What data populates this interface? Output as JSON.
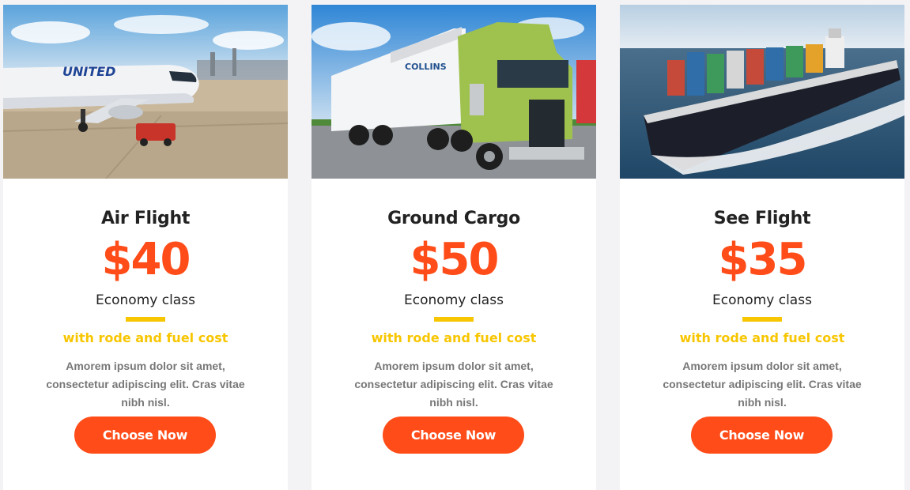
{
  "colors": {
    "accent": "#ff4c18",
    "highlight": "#f7c600",
    "background": "#f3f3f5",
    "card": "#ffffff"
  },
  "cards": [
    {
      "image": "airplane-photo",
      "title": "Air Flight",
      "price": "$40",
      "class_label": "Economy class",
      "note": "with rode and fuel cost",
      "description": "Amorem ipsum dolor sit amet, consectetur adipiscing elit. Cras vitae nibh nisl.",
      "button_label": "Choose Now"
    },
    {
      "image": "truck-photo",
      "title": "Ground Cargo",
      "price": "$50",
      "class_label": "Economy class",
      "note": "with rode and fuel cost",
      "description": "Amorem ipsum dolor sit amet, consectetur adipiscing elit. Cras vitae nibh nisl.",
      "button_label": "Choose Now"
    },
    {
      "image": "cargo-ship-photo",
      "title": "See Flight",
      "price": "$35",
      "class_label": "Economy class",
      "note": "with rode and fuel cost",
      "description": "Amorem ipsum dolor sit amet, consectetur adipiscing elit. Cras vitae nibh nisl.",
      "button_label": "Choose Now"
    }
  ]
}
